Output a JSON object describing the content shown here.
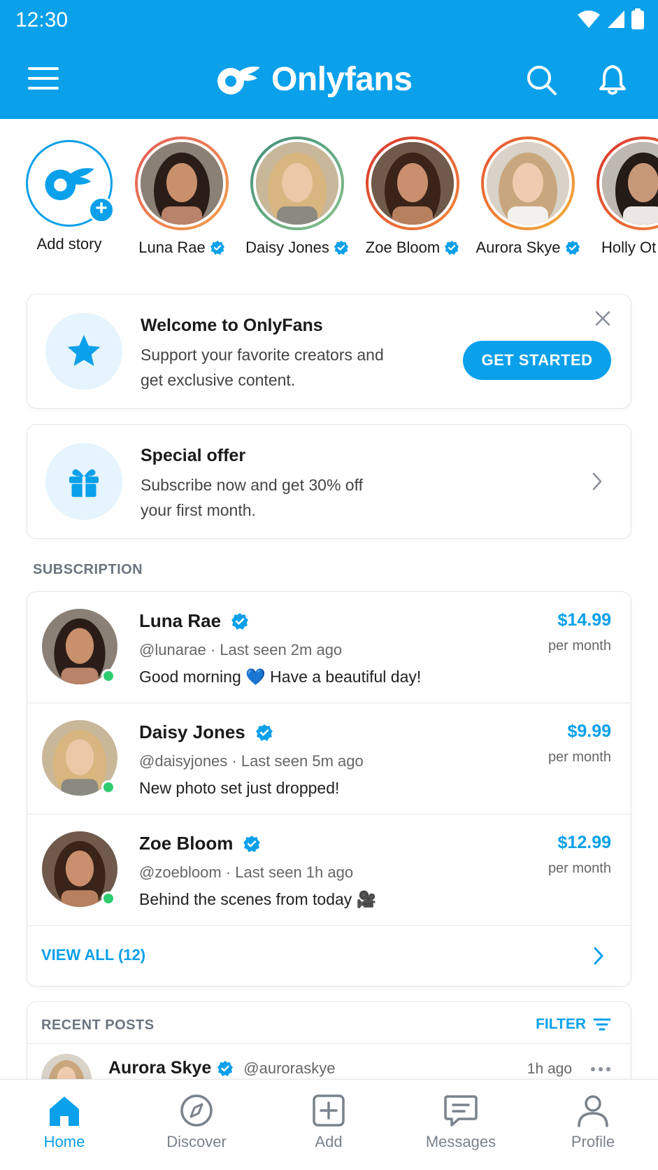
{
  "status_bar": {
    "time": "12:30"
  },
  "header": {
    "brand": "Onlyfans"
  },
  "stories": [
    {
      "name": "Add story",
      "kind": "add"
    },
    {
      "name": "Luna Rae",
      "verified": true,
      "ring": "#d9534f"
    },
    {
      "name": "Daisy Jones",
      "verified": true,
      "ring": "#5aa469"
    },
    {
      "name": "Zoe Bloom",
      "verified": true,
      "ring": "#e0602f"
    },
    {
      "name": "Aurora Skye",
      "verified": true,
      "ring": "#e8862f"
    },
    {
      "name": "Holly Ot",
      "verified": false,
      "ring": "#d9534f"
    }
  ],
  "welcome": {
    "title": "Welcome to OnlyFans",
    "text": "Support your favorite creators and get exclusive content.",
    "cta": "GET STARTED"
  },
  "offer": {
    "title": "Special offer",
    "text": "Subscribe now and get 30% off your first month."
  },
  "subscription": {
    "label": "SUBSCRIPTION",
    "items": [
      {
        "name": "Luna Rae",
        "meta": "@lunarae · Last seen 2m ago",
        "message": "Good morning 💙 Have a beautiful day!",
        "price": "$14.99",
        "per": "per month"
      },
      {
        "name": "Daisy Jones",
        "meta": "@daisyjones · Last seen 5m ago",
        "message": "New photo set just dropped!",
        "price": "$9.99",
        "per": "per month"
      },
      {
        "name": "Zoe Bloom",
        "meta": "@zoebloom · Last seen 1h ago",
        "message": "Behind the scenes from today 🎥",
        "price": "$12.99",
        "per": "per month"
      }
    ],
    "view_all": "VIEW ALL (12)"
  },
  "recent_posts": {
    "label": "RECENT POSTS",
    "filter": "FILTER",
    "first": {
      "name": "Aurora Skye",
      "handle": "@auroraskye",
      "time": "1h ago"
    }
  },
  "nav": [
    {
      "label": "Home",
      "active": true
    },
    {
      "label": "Discover"
    },
    {
      "label": "Add"
    },
    {
      "label": "Messages"
    },
    {
      "label": "Profile"
    }
  ],
  "colors": {
    "accent": "#0aa0ea",
    "online": "#2ecc71"
  }
}
